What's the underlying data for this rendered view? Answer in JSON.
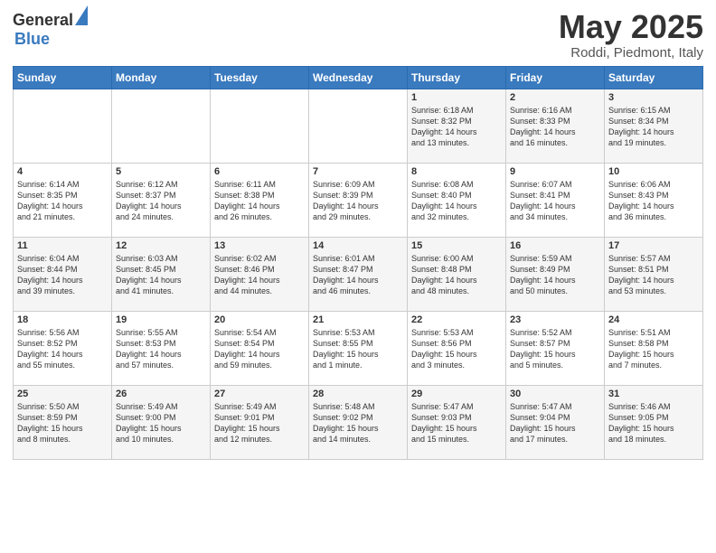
{
  "logo": {
    "general": "General",
    "blue": "Blue"
  },
  "title": "May 2025",
  "subtitle": "Roddi, Piedmont, Italy",
  "days_header": [
    "Sunday",
    "Monday",
    "Tuesday",
    "Wednesday",
    "Thursday",
    "Friday",
    "Saturday"
  ],
  "weeks": [
    [
      {
        "day": "",
        "info": ""
      },
      {
        "day": "",
        "info": ""
      },
      {
        "day": "",
        "info": ""
      },
      {
        "day": "",
        "info": ""
      },
      {
        "day": "1",
        "info": "Sunrise: 6:18 AM\nSunset: 8:32 PM\nDaylight: 14 hours\nand 13 minutes."
      },
      {
        "day": "2",
        "info": "Sunrise: 6:16 AM\nSunset: 8:33 PM\nDaylight: 14 hours\nand 16 minutes."
      },
      {
        "day": "3",
        "info": "Sunrise: 6:15 AM\nSunset: 8:34 PM\nDaylight: 14 hours\nand 19 minutes."
      }
    ],
    [
      {
        "day": "4",
        "info": "Sunrise: 6:14 AM\nSunset: 8:35 PM\nDaylight: 14 hours\nand 21 minutes."
      },
      {
        "day": "5",
        "info": "Sunrise: 6:12 AM\nSunset: 8:37 PM\nDaylight: 14 hours\nand 24 minutes."
      },
      {
        "day": "6",
        "info": "Sunrise: 6:11 AM\nSunset: 8:38 PM\nDaylight: 14 hours\nand 26 minutes."
      },
      {
        "day": "7",
        "info": "Sunrise: 6:09 AM\nSunset: 8:39 PM\nDaylight: 14 hours\nand 29 minutes."
      },
      {
        "day": "8",
        "info": "Sunrise: 6:08 AM\nSunset: 8:40 PM\nDaylight: 14 hours\nand 32 minutes."
      },
      {
        "day": "9",
        "info": "Sunrise: 6:07 AM\nSunset: 8:41 PM\nDaylight: 14 hours\nand 34 minutes."
      },
      {
        "day": "10",
        "info": "Sunrise: 6:06 AM\nSunset: 8:43 PM\nDaylight: 14 hours\nand 36 minutes."
      }
    ],
    [
      {
        "day": "11",
        "info": "Sunrise: 6:04 AM\nSunset: 8:44 PM\nDaylight: 14 hours\nand 39 minutes."
      },
      {
        "day": "12",
        "info": "Sunrise: 6:03 AM\nSunset: 8:45 PM\nDaylight: 14 hours\nand 41 minutes."
      },
      {
        "day": "13",
        "info": "Sunrise: 6:02 AM\nSunset: 8:46 PM\nDaylight: 14 hours\nand 44 minutes."
      },
      {
        "day": "14",
        "info": "Sunrise: 6:01 AM\nSunset: 8:47 PM\nDaylight: 14 hours\nand 46 minutes."
      },
      {
        "day": "15",
        "info": "Sunrise: 6:00 AM\nSunset: 8:48 PM\nDaylight: 14 hours\nand 48 minutes."
      },
      {
        "day": "16",
        "info": "Sunrise: 5:59 AM\nSunset: 8:49 PM\nDaylight: 14 hours\nand 50 minutes."
      },
      {
        "day": "17",
        "info": "Sunrise: 5:57 AM\nSunset: 8:51 PM\nDaylight: 14 hours\nand 53 minutes."
      }
    ],
    [
      {
        "day": "18",
        "info": "Sunrise: 5:56 AM\nSunset: 8:52 PM\nDaylight: 14 hours\nand 55 minutes."
      },
      {
        "day": "19",
        "info": "Sunrise: 5:55 AM\nSunset: 8:53 PM\nDaylight: 14 hours\nand 57 minutes."
      },
      {
        "day": "20",
        "info": "Sunrise: 5:54 AM\nSunset: 8:54 PM\nDaylight: 14 hours\nand 59 minutes."
      },
      {
        "day": "21",
        "info": "Sunrise: 5:53 AM\nSunset: 8:55 PM\nDaylight: 15 hours\nand 1 minute."
      },
      {
        "day": "22",
        "info": "Sunrise: 5:53 AM\nSunset: 8:56 PM\nDaylight: 15 hours\nand 3 minutes."
      },
      {
        "day": "23",
        "info": "Sunrise: 5:52 AM\nSunset: 8:57 PM\nDaylight: 15 hours\nand 5 minutes."
      },
      {
        "day": "24",
        "info": "Sunrise: 5:51 AM\nSunset: 8:58 PM\nDaylight: 15 hours\nand 7 minutes."
      }
    ],
    [
      {
        "day": "25",
        "info": "Sunrise: 5:50 AM\nSunset: 8:59 PM\nDaylight: 15 hours\nand 8 minutes."
      },
      {
        "day": "26",
        "info": "Sunrise: 5:49 AM\nSunset: 9:00 PM\nDaylight: 15 hours\nand 10 minutes."
      },
      {
        "day": "27",
        "info": "Sunrise: 5:49 AM\nSunset: 9:01 PM\nDaylight: 15 hours\nand 12 minutes."
      },
      {
        "day": "28",
        "info": "Sunrise: 5:48 AM\nSunset: 9:02 PM\nDaylight: 15 hours\nand 14 minutes."
      },
      {
        "day": "29",
        "info": "Sunrise: 5:47 AM\nSunset: 9:03 PM\nDaylight: 15 hours\nand 15 minutes."
      },
      {
        "day": "30",
        "info": "Sunrise: 5:47 AM\nSunset: 9:04 PM\nDaylight: 15 hours\nand 17 minutes."
      },
      {
        "day": "31",
        "info": "Sunrise: 5:46 AM\nSunset: 9:05 PM\nDaylight: 15 hours\nand 18 minutes."
      }
    ]
  ]
}
